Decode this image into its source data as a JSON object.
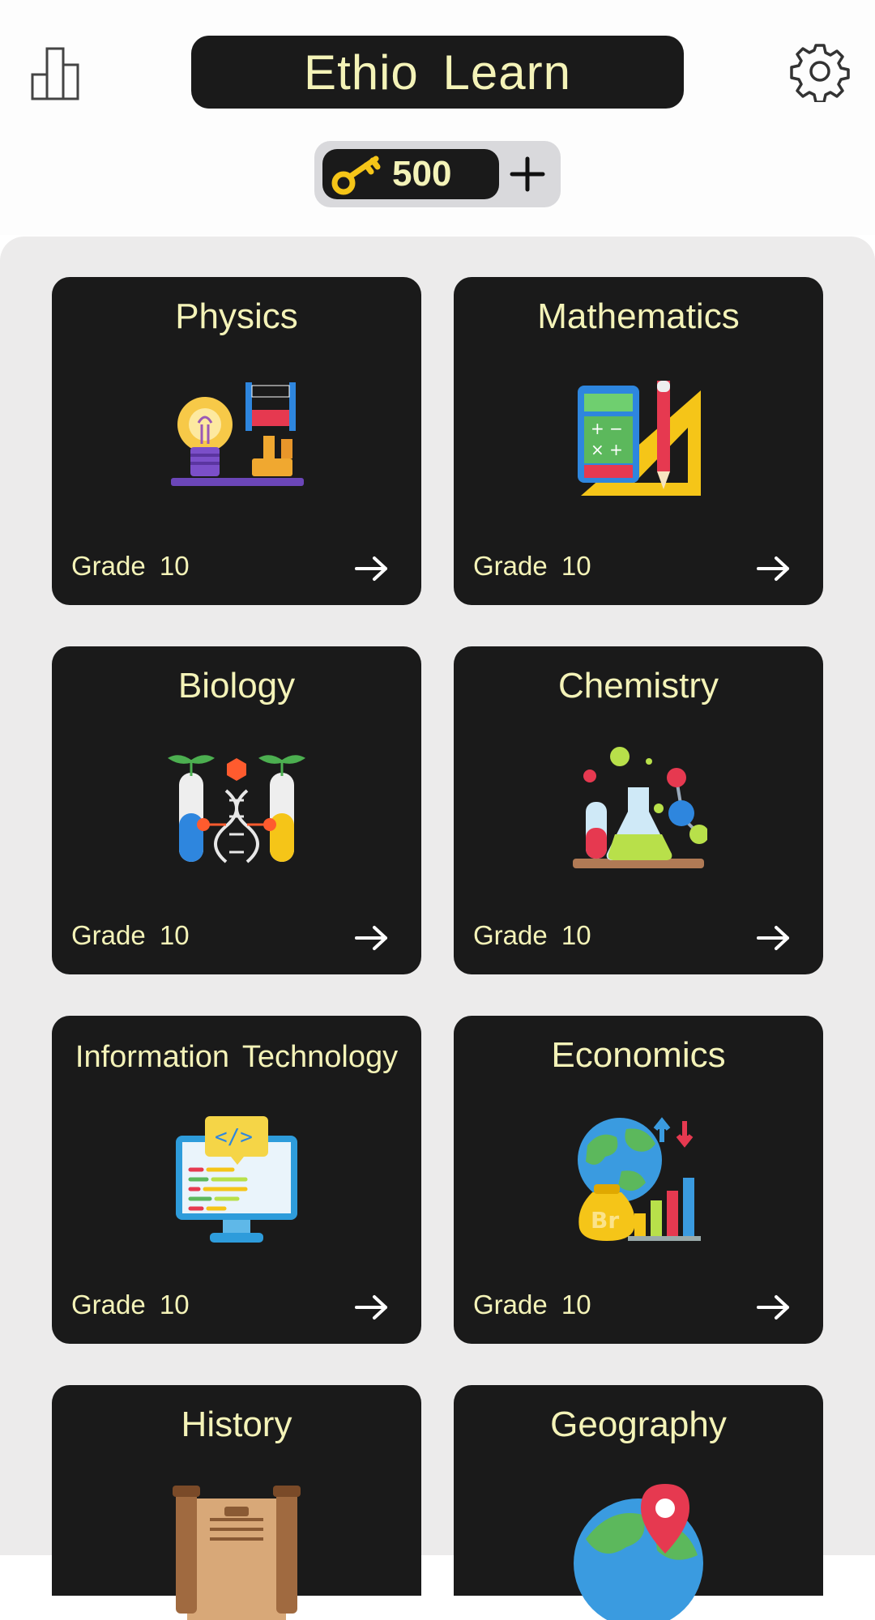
{
  "header": {
    "app_title": "Ethio Learn",
    "stats_icon": "bar-chart-icon",
    "settings_icon": "gear-icon"
  },
  "keys": {
    "icon": "key-icon",
    "count": "500",
    "add_icon": "plus-icon"
  },
  "colors": {
    "card_bg": "#1a1a1a",
    "text_accent": "#f4f3b8",
    "page_bg": "#ecebeb",
    "key_gold": "#f5c518"
  },
  "subjects": [
    {
      "title": "Physics",
      "grade": "Grade 10",
      "icon": "lightbulb-physics-icon"
    },
    {
      "title": "Mathematics",
      "grade": "Grade 10",
      "icon": "calculator-ruler-icon"
    },
    {
      "title": "Biology",
      "grade": "Grade 10",
      "icon": "dna-test-tubes-icon"
    },
    {
      "title": "Chemistry",
      "grade": "Grade 10",
      "icon": "flask-molecule-icon"
    },
    {
      "title": "Information Technology",
      "grade": "Grade 10",
      "icon": "computer-code-icon"
    },
    {
      "title": "Economics",
      "grade": "Grade 10",
      "icon": "globe-money-chart-icon"
    },
    {
      "title": "History",
      "grade": "",
      "icon": "scroll-icon"
    },
    {
      "title": "Geography",
      "grade": "",
      "icon": "globe-pin-icon"
    }
  ]
}
